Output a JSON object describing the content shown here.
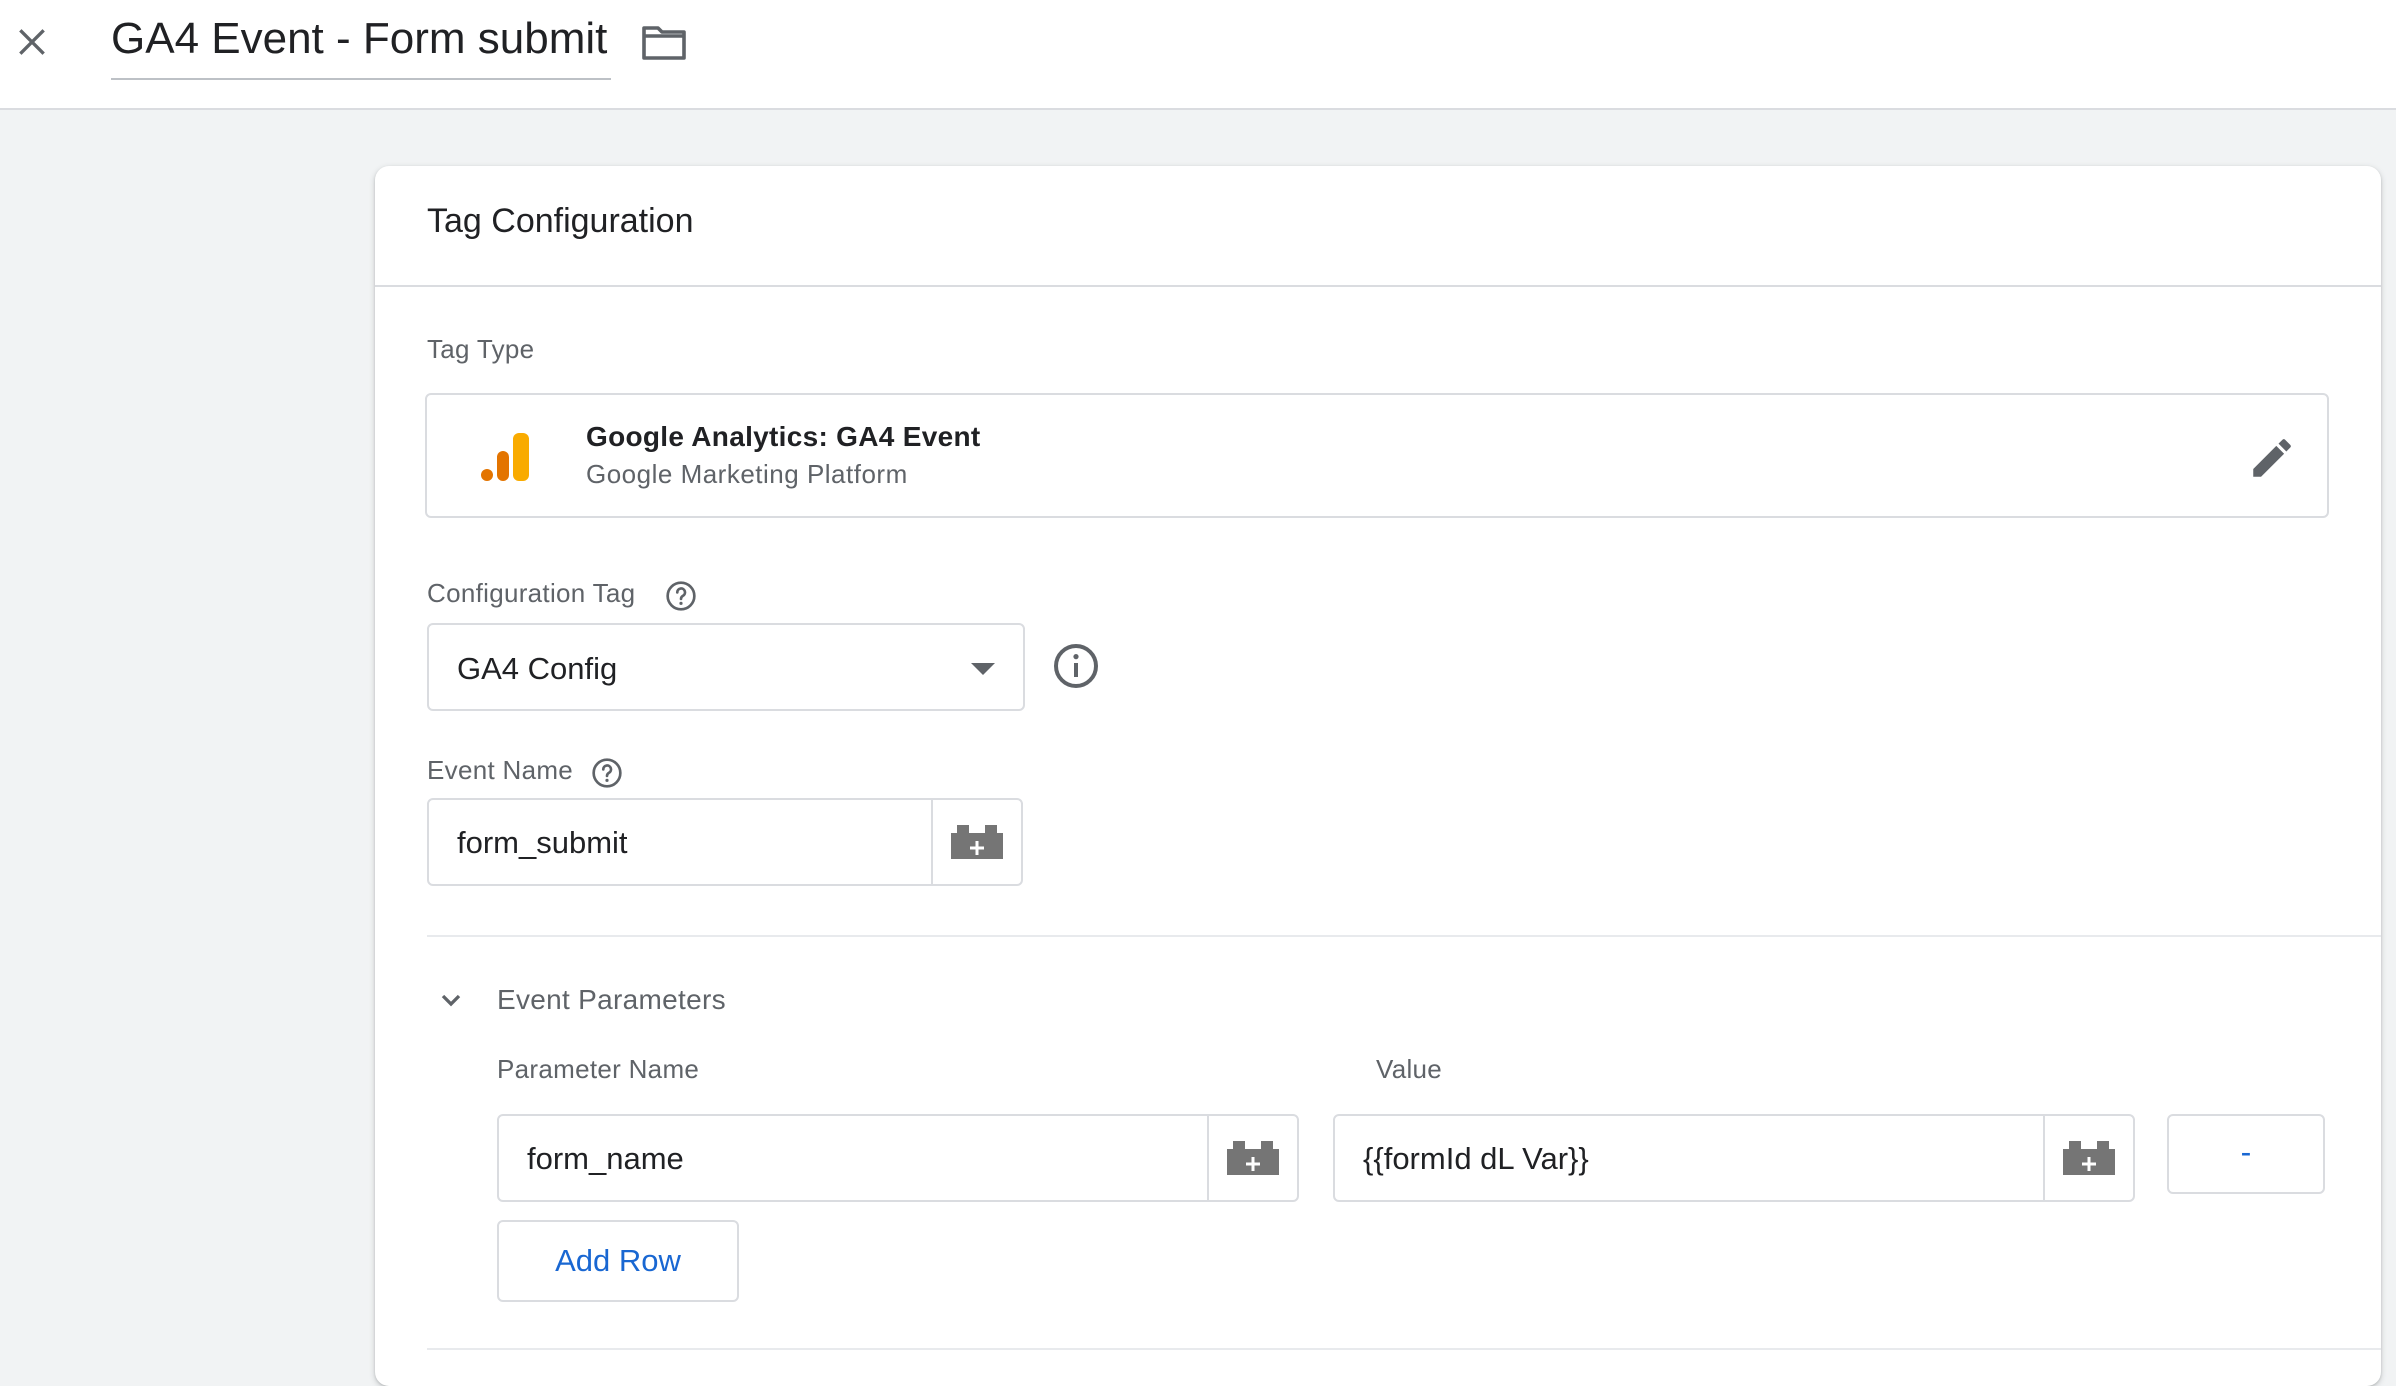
{
  "header": {
    "title": "GA4 Event - Form submit",
    "close_icon": "close-icon",
    "folder_icon": "folder-icon"
  },
  "card": {
    "title": "Tag Configuration"
  },
  "tag_type": {
    "label": "Tag Type",
    "name": "Google Analytics: GA4 Event",
    "platform": "Google Marketing Platform",
    "logo_icon": "google-analytics-logo",
    "edit_icon": "pencil-icon"
  },
  "configuration_tag": {
    "label": "Configuration Tag",
    "value": "GA4 Config"
  },
  "event_name": {
    "label": "Event Name",
    "value": "form_submit"
  },
  "event_parameters": {
    "title": "Event Parameters",
    "columns": {
      "name": "Parameter Name",
      "value": "Value"
    },
    "rows": [
      {
        "name": "form_name",
        "value": "{{formId dL Var}}",
        "remove_label": "-"
      }
    ],
    "add_row_label": "Add Row"
  },
  "colors": {
    "accent_blue": "#1967d2",
    "analytics_orange": "#f9ab00",
    "analytics_dark_orange": "#e37400",
    "border": "#dadce0",
    "page_background": "#f1f3f4"
  }
}
